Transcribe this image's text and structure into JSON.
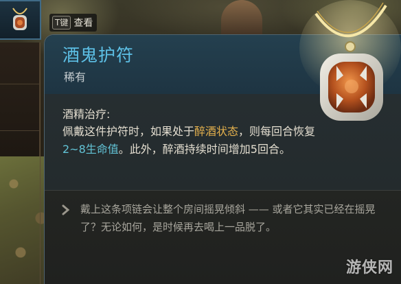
{
  "key_hint": {
    "key": "T键",
    "label": "查看"
  },
  "item": {
    "name": "酒鬼护符",
    "rarity": "稀有",
    "effect_heading": "酒精治疗:",
    "effect_text": {
      "part1": "佩戴这件护符时，如果处于",
      "drunk": "醉酒状态",
      "part2": "，则每回合恢复",
      "heal": "2~8生命值",
      "part3": "。此外，醉酒持续时间增加5回合。"
    },
    "flavor_text": "戴上这条项链会让整个房间摇晃倾斜 —— 或者它其实已经在摇晃了？无论如何，是时候再去喝上一品脱了。"
  },
  "watermark": "游侠网",
  "colors": {
    "title": "#5dc0e6",
    "highlight_gold": "#e5b14d",
    "highlight_cyan": "#62c3d6",
    "slot_border": "#3f6a86"
  },
  "icons": {
    "slot": "amulet-icon",
    "flavor": "quote-feather-icon",
    "art": "amulet-artwork"
  }
}
